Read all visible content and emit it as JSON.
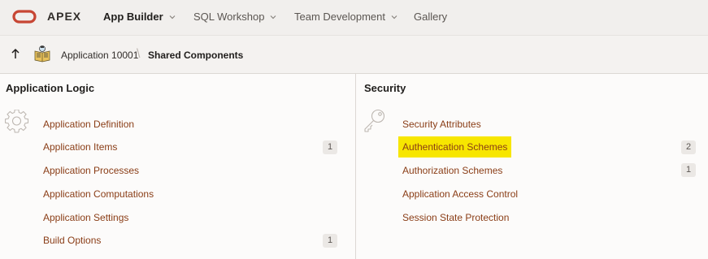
{
  "header": {
    "brand": "APEX",
    "nav": [
      {
        "label": "App Builder",
        "active": true,
        "dropdown": true
      },
      {
        "label": "SQL Workshop",
        "active": false,
        "dropdown": true
      },
      {
        "label": "Team Development",
        "active": false,
        "dropdown": true
      },
      {
        "label": "Gallery",
        "active": false,
        "dropdown": false
      }
    ],
    "logo_color": "#c74634"
  },
  "breadcrumb": {
    "application": "Application 10001",
    "separator": "\\",
    "current": "Shared Components"
  },
  "application_logic": {
    "title": "Application Logic",
    "icon": "gear-icon",
    "items": [
      {
        "label": "Application Definition",
        "count": ""
      },
      {
        "label": "Application Items",
        "count": "1"
      },
      {
        "label": "Application Processes",
        "count": ""
      },
      {
        "label": "Application Computations",
        "count": ""
      },
      {
        "label": "Application Settings",
        "count": ""
      },
      {
        "label": "Build Options",
        "count": "1"
      }
    ]
  },
  "security": {
    "title": "Security",
    "icon": "key-icon",
    "items": [
      {
        "label": "Security Attributes",
        "count": ""
      },
      {
        "label": "Authentication Schemes",
        "count": "2",
        "highlighted": true
      },
      {
        "label": "Authorization Schemes",
        "count": "1"
      },
      {
        "label": "Application Access Control",
        "count": ""
      },
      {
        "label": "Session State Protection",
        "count": ""
      }
    ]
  },
  "colors": {
    "link": "#8a3d16",
    "highlight": "#f7e600"
  }
}
